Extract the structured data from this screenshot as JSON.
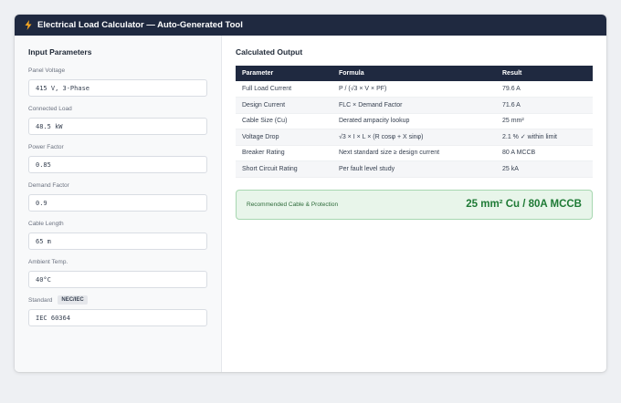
{
  "window": {
    "title": "Electrical Load Calculator — Auto-Generated Tool",
    "accent_color": "#1f2940",
    "icon": "lightning-bolt-icon"
  },
  "inputs": {
    "heading": "Input Parameters",
    "fields": [
      {
        "label": "Panel Voltage",
        "value": "415 V, 3-Phase"
      },
      {
        "label": "Connected Load",
        "value": "48.5 kW"
      },
      {
        "label": "Power Factor",
        "value": "0.85"
      },
      {
        "label": "Demand Factor",
        "value": "0.9"
      },
      {
        "label": "Cable Length",
        "value": "65 m"
      },
      {
        "label": "Ambient Temp.",
        "value": "40°C"
      },
      {
        "label": "Standard",
        "badge": "NEC/IEC",
        "value": "IEC 60364"
      }
    ]
  },
  "output": {
    "heading": "Calculated Output",
    "columns": [
      "Parameter",
      "Formula",
      "Result"
    ],
    "rows": [
      [
        "Full Load Current",
        "P / (√3 × V × PF)",
        "79.6 A"
      ],
      [
        "Design Current",
        "FLC × Demand Factor",
        "71.6 A"
      ],
      [
        "Cable Size (Cu)",
        "Derated ampacity lookup",
        "25 mm²"
      ],
      [
        "Voltage Drop",
        "√3 × I × L × (R cosφ + X sinφ)",
        "2.1 % ✓ within limit"
      ],
      [
        "Breaker Rating",
        "Next standard size ≥ design current",
        "80 A MCCB"
      ],
      [
        "Short Circuit Rating",
        "Per fault level study",
        "25 kA"
      ]
    ],
    "recommendation": {
      "label": "Recommended Cable & Protection",
      "value": "25 mm² Cu / 80A MCCB",
      "color": "#1e7a35"
    }
  }
}
